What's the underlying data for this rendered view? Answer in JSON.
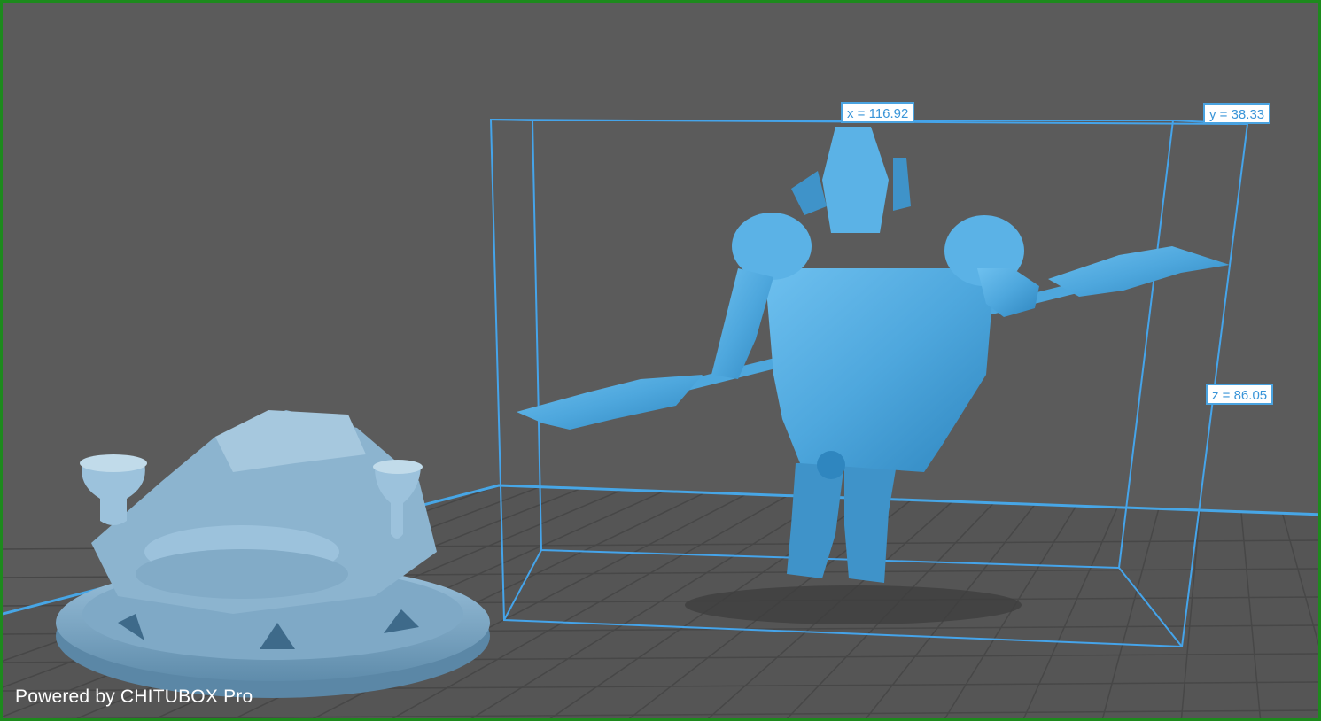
{
  "app": {
    "watermark": "Powered by CHITUBOX Pro"
  },
  "dimensions": {
    "x_label": "x = 116.92",
    "y_label": "y = 38.33",
    "z_label": "z = 86.05"
  },
  "colors": {
    "background": "#5b5b5b",
    "grid": "#4c4c4c",
    "platform_edge": "#47a6e6",
    "bounding_box": "#45a4ea",
    "selected_model": "#4ea7dd",
    "unselected_model": "#7fa9c6",
    "frame": "#1d8a1d"
  },
  "models": [
    {
      "name": "diorama-base",
      "state": "unselected"
    },
    {
      "name": "armored-warrior-with-glaive",
      "state": "selected"
    }
  ]
}
